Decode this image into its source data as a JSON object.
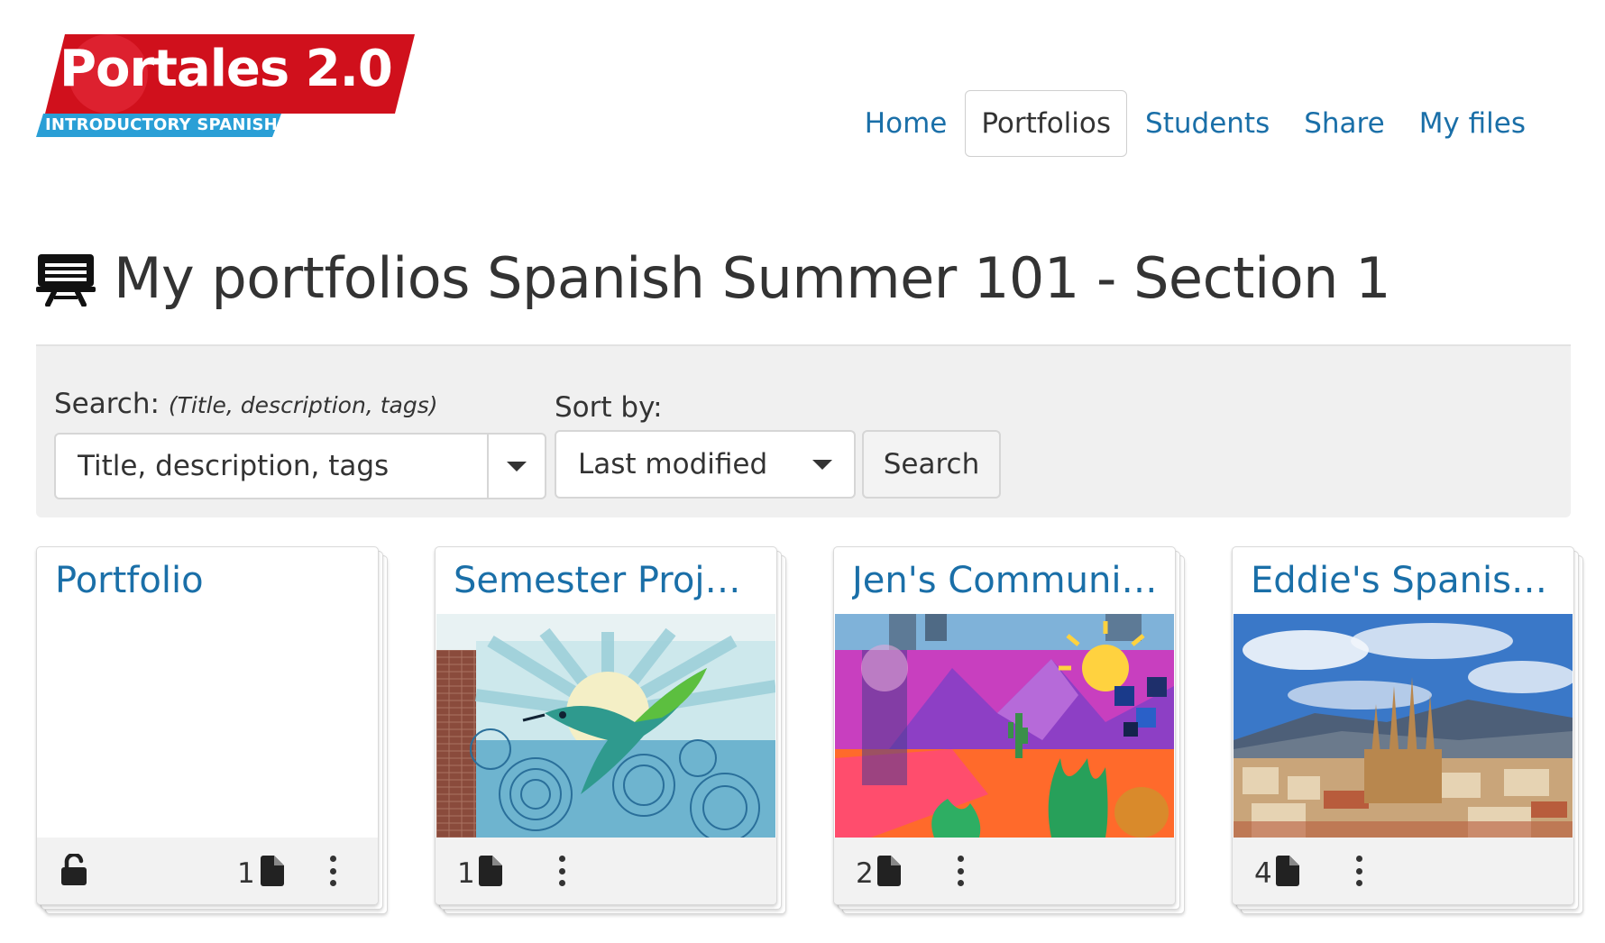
{
  "logo": {
    "title": "Portales 2.0",
    "subtitle": "INTRODUCTORY SPANISH",
    "red": "#d0101c",
    "blue": "#2a9fd6"
  },
  "nav": {
    "items": [
      {
        "label": "Home",
        "active": false
      },
      {
        "label": "Portfolios",
        "active": true
      },
      {
        "label": "Students",
        "active": false
      },
      {
        "label": "Share",
        "active": false
      },
      {
        "label": "My files",
        "active": false
      }
    ]
  },
  "page": {
    "title": "My portfolios Spanish Summer 101 - Section 1",
    "icon": "presentation-board-icon"
  },
  "search": {
    "label": "Search:",
    "hint": "(Title, description, tags)",
    "placeholder": "Title, description, tags",
    "sort_label": "Sort by:",
    "sort_value": "Last modified",
    "button_label": "Search"
  },
  "cards": [
    {
      "title": "Portfolio",
      "count": "1",
      "has_lock": true,
      "image": "none"
    },
    {
      "title": "Semester Projec...",
      "count": "1",
      "has_lock": false,
      "image": "hummingbird-mural"
    },
    {
      "title": "Jen's Communit...",
      "count": "2",
      "has_lock": false,
      "image": "desert-mural"
    },
    {
      "title": "Eddie's Spanish ...",
      "count": "4",
      "has_lock": false,
      "image": "barcelona-skyline"
    }
  ],
  "colors": {
    "link": "#1a6fa8",
    "text": "#333333",
    "panel": "#f0f0f0"
  }
}
